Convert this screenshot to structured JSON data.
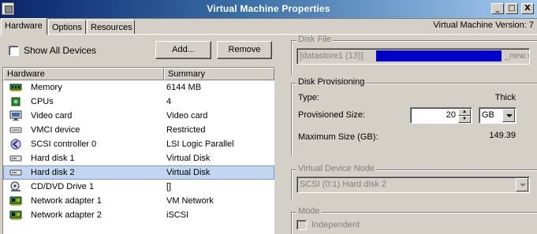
{
  "window": {
    "title": "Virtual Machine Properties",
    "buttons": {
      "minimize": "_",
      "maximize": "□",
      "close": "X"
    }
  },
  "tabs": [
    {
      "label": "Hardware",
      "active": true
    },
    {
      "label": "Options",
      "active": false
    },
    {
      "label": "Resources",
      "active": false
    }
  ],
  "vm_version": "Virtual Machine Version: 7",
  "toolbar": {
    "show_all_devices": "Show All Devices",
    "show_all_checked": false,
    "add_label": "Add...",
    "remove_label": "Remove"
  },
  "hardware_table": {
    "columns": [
      "Hardware",
      "Summary"
    ],
    "rows": [
      {
        "name": "Memory",
        "summary": "6144 MB",
        "icon": "memory-icon",
        "selected": false
      },
      {
        "name": "CPUs",
        "summary": "4",
        "icon": "cpu-icon",
        "selected": false
      },
      {
        "name": "Video card",
        "summary": "Video card",
        "icon": "monitor-icon",
        "selected": false
      },
      {
        "name": "VMCI device",
        "summary": "Restricted",
        "icon": "vmci-device-icon",
        "selected": false
      },
      {
        "name": "SCSI controller 0",
        "summary": "LSI Logic Parallel",
        "icon": "scsi-controller-icon",
        "selected": false
      },
      {
        "name": "Hard disk 1",
        "summary": "Virtual Disk",
        "icon": "hard-disk-icon",
        "selected": false
      },
      {
        "name": "Hard disk 2",
        "summary": "Virtual Disk",
        "icon": "hard-disk-icon",
        "selected": true
      },
      {
        "name": "CD/DVD Drive 1",
        "summary": "[]",
        "icon": "cd-dvd-icon",
        "selected": false
      },
      {
        "name": "Network adapter 1",
        "summary": "VM Network",
        "icon": "network-adapter-icon",
        "selected": false
      },
      {
        "name": "Network adapter 2",
        "summary": "iSCSI",
        "icon": "network-adapter-icon",
        "selected": false
      }
    ]
  },
  "disk_file": {
    "title": "Disk File",
    "value_prefix": "[datastore1 (13)]",
    "value_suffix": "_new.v"
  },
  "disk_provisioning": {
    "title": "Disk Provisioning",
    "type_label": "Type:",
    "type_value": "Thick",
    "provisioned_label": "Provisioned Size:",
    "provisioned_value": "20",
    "unit": "GB",
    "max_label": "Maximum Size (GB):",
    "max_value": "149.39"
  },
  "virtual_device_node": {
    "title": "Virtual Device Node",
    "value": "SCSI (0:1) Hard disk 2"
  },
  "mode": {
    "title": "Mode",
    "independent_label": "Independent",
    "independent_checked": false
  },
  "colors": {
    "titlebar_start": "#0a246a",
    "titlebar_end": "#a6caf0",
    "dialog_bg": "#d4d0c8",
    "selection": "#c3d6ef",
    "redaction": "#0000c8"
  }
}
